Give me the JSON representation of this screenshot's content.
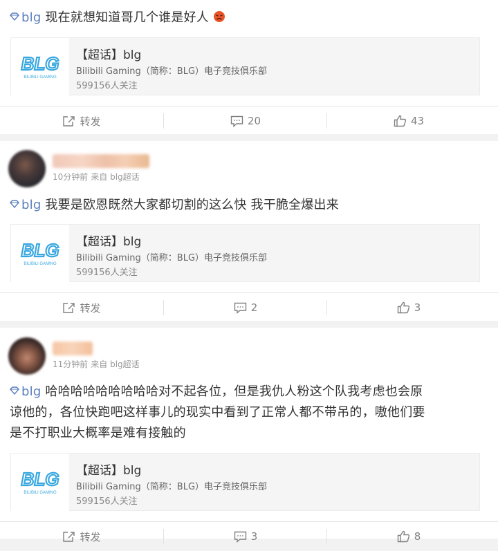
{
  "posts": [
    {
      "topic_tag": "blg",
      "text": "现在就想知道哥几个谁是好人",
      "card": {
        "title": "【超话】blg",
        "desc": "Bilibili Gaming（简称：BLG）电子竞技俱乐部",
        "follow": "599156人关注",
        "logo_text": "BLG",
        "logo_sub": "BILIBILI GAMING"
      },
      "repost_label": "转发",
      "comment_count": "20",
      "like_count": "43"
    },
    {
      "time": "10分钟前",
      "source": "来自 blg超话",
      "topic_tag": "blg",
      "text": "我要是欧恩既然大家都切割的这么快 我干脆全爆出来",
      "card": {
        "title": "【超话】blg",
        "desc": "Bilibili Gaming（简称：BLG）电子竞技俱乐部",
        "follow": "599156人关注",
        "logo_text": "BLG",
        "logo_sub": "BILIBILI GAMING"
      },
      "repost_label": "转发",
      "comment_count": "2",
      "like_count": "3"
    },
    {
      "time": "11分钟前",
      "source": "来自 blg超话",
      "topic_tag": "blg",
      "text_line1": "哈哈哈哈哈哈哈哈哈对不起各位，但是我仇人粉这个队我考虑也会原",
      "text_line2": "谅他的，各位快跑吧这样事儿的现实中看到了正常人都不带吊的，嗷他们要",
      "text_line3": "是不打职业大概率是难有接触的",
      "card": {
        "title": "【超话】blg",
        "desc": "Bilibili Gaming（简称：BLG）电子竞技俱乐部",
        "follow": "599156人关注",
        "logo_text": "BLG",
        "logo_sub": "BILIBILI GAMING"
      },
      "repost_label": "转发",
      "comment_count": "3",
      "like_count": "8"
    }
  ],
  "colors": {
    "topic_link": "#5b7fbf",
    "logo_blue": "#3aa8e0",
    "icon_gray": "#808080"
  },
  "icons": [
    "diamond-icon",
    "repost-icon",
    "comment-icon",
    "like-icon",
    "emoji-icon"
  ]
}
